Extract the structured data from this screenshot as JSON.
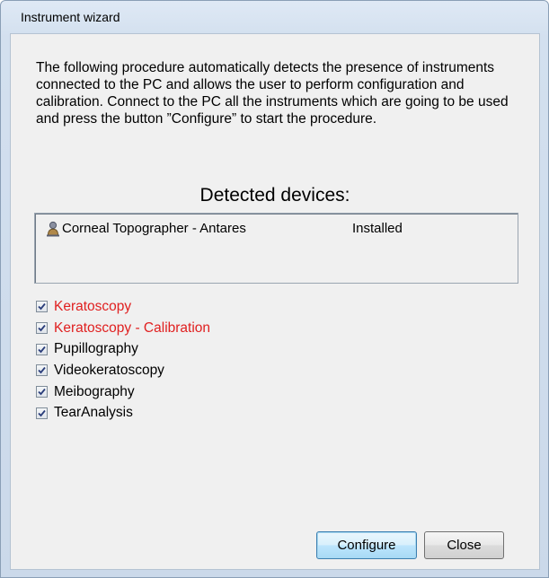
{
  "window": {
    "title": "Instrument wizard"
  },
  "description": "The following procedure automatically detects the presence of instruments connected to the PC and allows the user to perform configuration and calibration. Connect to the PC all the instruments which are going to be used and press the button ”Configure” to start the procedure.",
  "detected": {
    "title": "Detected devices:",
    "devices": [
      {
        "icon": "user-device-icon",
        "name": "Corneal Topographer - Antares",
        "status": "Installed"
      }
    ]
  },
  "procedures": [
    {
      "label": "Keratoscopy",
      "checked": true,
      "color": "#e02020"
    },
    {
      "label": "Keratoscopy - Calibration",
      "checked": true,
      "color": "#e02020"
    },
    {
      "label": "Pupillography",
      "checked": true,
      "color": "#000000"
    },
    {
      "label": "Videokeratoscopy",
      "checked": true,
      "color": "#000000"
    },
    {
      "label": "Meibography",
      "checked": true,
      "color": "#000000"
    },
    {
      "label": "TearAnalysis",
      "checked": true,
      "color": "#000000"
    }
  ],
  "buttons": {
    "configure": "Configure",
    "close": "Close"
  }
}
